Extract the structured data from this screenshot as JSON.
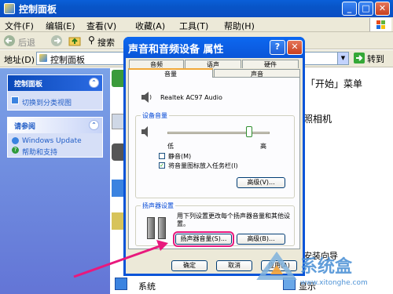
{
  "explorer": {
    "title": "控制面板",
    "menu": [
      "文件(F)",
      "编辑(E)",
      "查看(V)",
      "收藏(A)",
      "工具(T)",
      "帮助(H)"
    ],
    "toolbar": {
      "back": "后退",
      "search": "搜索"
    },
    "address_label": "地址(D)",
    "address_value": "控制面板",
    "go_label": "转到"
  },
  "taskpane": {
    "panel_title": "控制面板",
    "switch_link": "切换到分类视图",
    "see_also_title": "请参阅",
    "see_also_items": [
      "Windows Update",
      "帮助和支持"
    ]
  },
  "content": {
    "right_text_1": "「开始」菜单",
    "right_text_2": "照相机",
    "right_text_3": "安装向导",
    "bottom_left": "系统",
    "bottom_right": "显示"
  },
  "dialog": {
    "title": "声音和音频设备 属性",
    "tabs_row1": [
      "音频",
      "语声",
      "硬件"
    ],
    "tabs_row2": [
      "音量",
      "声音"
    ],
    "device_name": "Realtek AC97 Audio",
    "device_volume_group": "设备音量",
    "slider_low": "低",
    "slider_high": "高",
    "mute_label": "静音(M)",
    "tray_icon_label": "将音量图标放入任务栏(I)",
    "advanced_1": "高级(V)...",
    "speaker_group": "扬声器设置",
    "speaker_desc": "用下列设置更改每个扬声器音量和其他设置。",
    "speaker_volume_btn": "扬声器音量(S)...",
    "advanced_2": "高级(B)...",
    "ok": "确定",
    "cancel": "取消",
    "apply": "应用(A)",
    "slider_level": 0.8,
    "mute_checked": false,
    "tray_checked": true
  },
  "watermark": {
    "logo_text": "系统盒",
    "url": "www.xitonghe.com"
  },
  "colors": {
    "xp_blue": "#0a55d8",
    "highlight": "#e8197d",
    "dialog_bg": "#ece9d8"
  }
}
